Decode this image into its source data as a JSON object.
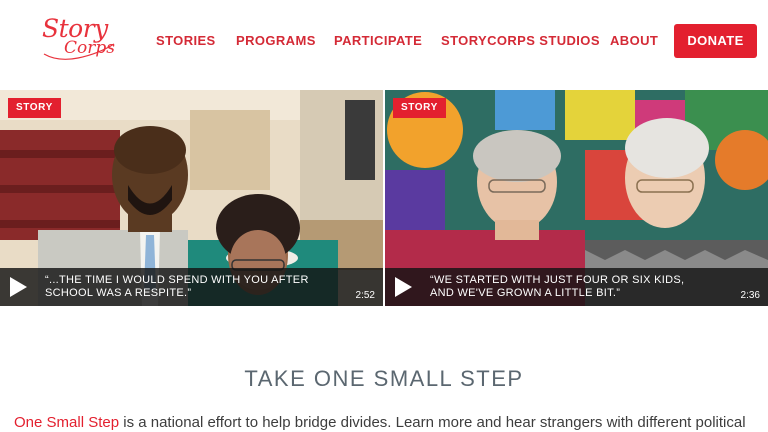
{
  "brand": {
    "logo_line1": "Story",
    "logo_line2": "Corps",
    "accent": "#e3202f",
    "nav_color": "#d42a36"
  },
  "nav": {
    "items": [
      {
        "label": "STORIES"
      },
      {
        "label": "PROGRAMS"
      },
      {
        "label": "PARTICIPATE"
      },
      {
        "label": "STORYCORPS STUDIOS"
      },
      {
        "label": "ABOUT"
      }
    ],
    "donate_label": "DONATE"
  },
  "videos": [
    {
      "badge": "STORY",
      "quote": "“...THE TIME I WOULD SPEND WITH YOU AFTER SCHOOL WAS A RESPITE.”",
      "duration": "2:52",
      "play_icon": "play-icon"
    },
    {
      "badge": "STORY",
      "quote": "“WE STARTED WITH JUST FOUR OR SIX KIDS, AND WE'VE GROWN A LITTLE BIT.”",
      "duration": "2:36",
      "play_icon": "play-icon"
    }
  ],
  "section": {
    "title": "TAKE ONE SMALL STEP",
    "link_text": "One Small Step",
    "body_text": " is a national effort to help bridge divides. Learn more and hear strangers with different political"
  }
}
